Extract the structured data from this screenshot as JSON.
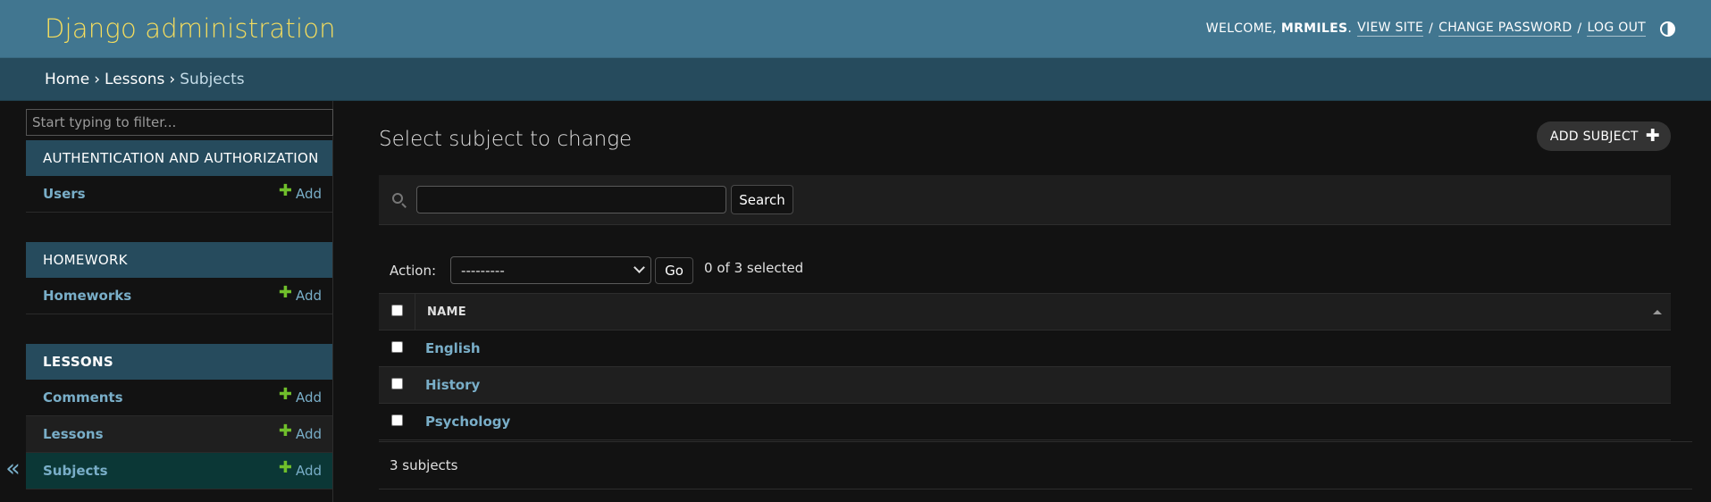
{
  "header": {
    "brand": "Django administration",
    "welcome": "WELCOME,",
    "username": "MRMILES",
    "username_suffix": ".",
    "view_site": "VIEW SITE",
    "change_password": "CHANGE PASSWORD",
    "log_out": "LOG OUT",
    "separator": "/"
  },
  "breadcrumbs": {
    "home": "Home",
    "app": "Lessons",
    "current": "Subjects",
    "separator": "›"
  },
  "sidebar": {
    "filter_placeholder": "Start typing to filter...",
    "toggle": "«",
    "add_label": "Add",
    "plus": "✚",
    "modules": [
      {
        "caption": "AUTHENTICATION AND AUTHORIZATION",
        "models": [
          {
            "name": "Users"
          }
        ]
      },
      {
        "caption": "HOMEWORK",
        "models": [
          {
            "name": "Homeworks"
          }
        ]
      },
      {
        "caption": "LESSONS",
        "models": [
          {
            "name": "Comments"
          },
          {
            "name": "Lessons"
          },
          {
            "name": "Subjects"
          }
        ]
      }
    ]
  },
  "content": {
    "title": "Select subject to change",
    "add_button": "ADD SUBJECT",
    "add_button_plus": "✚",
    "search_value": "",
    "search_button": "Search",
    "action_label": "Action:",
    "action_selected": "---------",
    "go_button": "Go",
    "selected_count": "0 of 3 selected",
    "column_name": "NAME",
    "rows": [
      "English",
      "History",
      "Psychology"
    ],
    "paginator": "3 subjects"
  },
  "colors": {
    "header_bg": "#417690",
    "brand": "#f5dd5d",
    "breadcrumbs_bg": "#264b5d",
    "link": "#79aec8",
    "add_plus": "#70bf2b",
    "current_row": "#0b3736"
  },
  "icons": {
    "theme_toggle": "half-circle-icon",
    "search": "magnifier-icon",
    "sort": "triangle-up-icon",
    "collapse": "double-chevron-left-icon"
  }
}
